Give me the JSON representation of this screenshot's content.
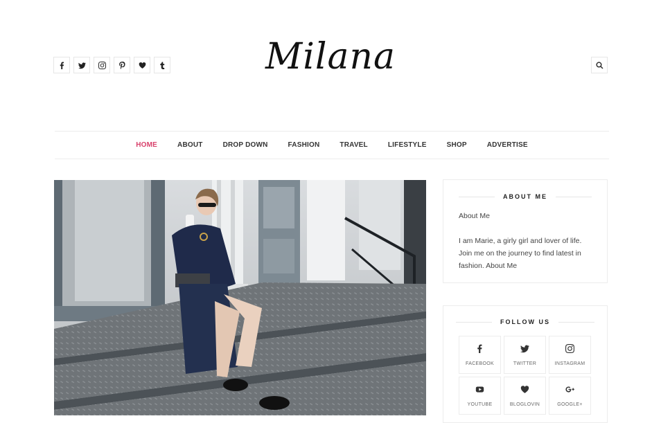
{
  "header": {
    "logo": "Milana",
    "social_icons": [
      "facebook-icon",
      "twitter-icon",
      "instagram-icon",
      "pinterest-icon",
      "heart-icon",
      "tumblr-icon"
    ],
    "search_icon": "search-icon"
  },
  "nav": {
    "items": [
      {
        "label": "HOME",
        "active": true
      },
      {
        "label": "ABOUT"
      },
      {
        "label": "DROP DOWN"
      },
      {
        "label": "FASHION"
      },
      {
        "label": "TRAVEL"
      },
      {
        "label": "LIFESTYLE"
      },
      {
        "label": "SHOP"
      },
      {
        "label": "ADVERTISE"
      }
    ]
  },
  "about_widget": {
    "title": "ABOUT ME",
    "heading": "About Me",
    "text": "I am Marie, a girly girl and lover of life. Join me on the journey to find latest in fashion. About Me"
  },
  "follow_widget": {
    "title": "FOLLOW US",
    "items": [
      {
        "label": "FACEBOOK",
        "icon": "facebook-icon"
      },
      {
        "label": "TWITTER",
        "icon": "twitter-icon"
      },
      {
        "label": "INSTAGRAM",
        "icon": "instagram-icon"
      },
      {
        "label": "YOUTUBE",
        "icon": "youtube-icon"
      },
      {
        "label": "BLOGLOVIN",
        "icon": "heart-icon"
      },
      {
        "label": "GOOGLE+",
        "icon": "google-plus-icon"
      }
    ]
  },
  "colors": {
    "accent": "#d8406b",
    "text": "#333333",
    "border": "#ececec"
  }
}
